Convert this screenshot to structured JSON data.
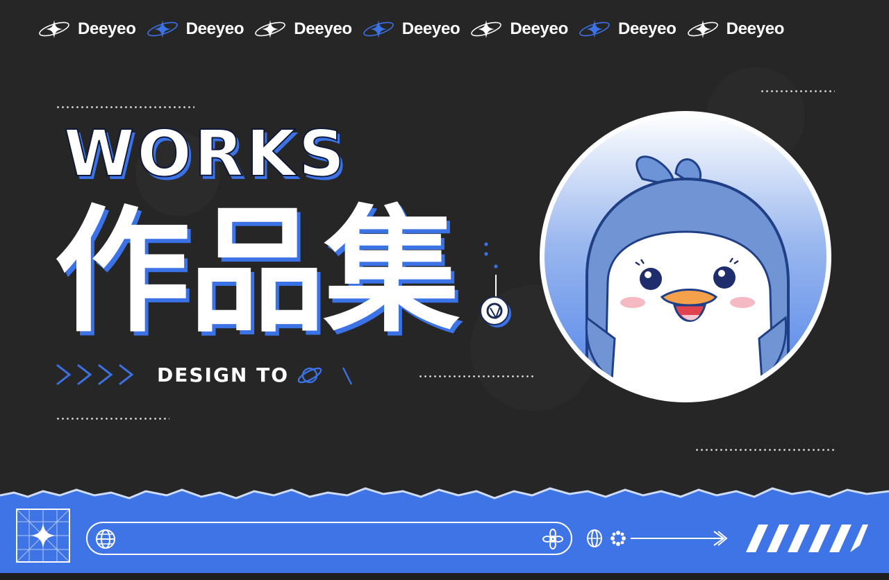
{
  "brand": {
    "items": [
      "Deeyeo",
      "Deeyeo",
      "Deeyeo",
      "Deeyeo",
      "Deeyeo",
      "Deeyeo",
      "Deeyeo"
    ],
    "icon_colors": [
      "#ffffff",
      "#3b72e6",
      "#ffffff",
      "#3b72e6",
      "#ffffff",
      "#3b72e6",
      "#ffffff"
    ]
  },
  "hero": {
    "title_en": "WORKS",
    "title_cn": "作品集",
    "tagline": "DESIGN TO"
  },
  "search": {
    "value": "",
    "placeholder": ""
  },
  "colors": {
    "background": "#262626",
    "accent": "#3b72e6",
    "text": "#ffffff"
  },
  "icons": {
    "brand": "sparkle-orbit-icon",
    "planet": "planet-icon",
    "globe": "globe-icon",
    "flower": "flower-icon",
    "arrow": "arrow-right-icon",
    "mascot": "penguin-mascot"
  }
}
